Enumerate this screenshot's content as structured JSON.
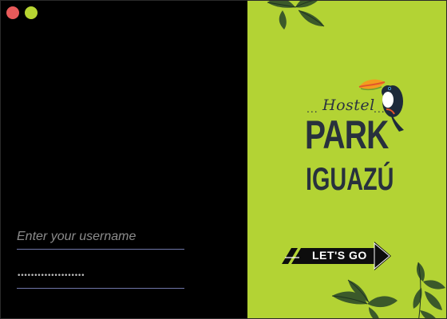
{
  "window": {
    "controls": [
      "close",
      "minimize"
    ]
  },
  "login": {
    "username_placeholder": "Enter your username",
    "password_value": "••••••••••••••••••••"
  },
  "brand": {
    "hostel": "Hostel",
    "dots_left": "...",
    "dots_right": "...",
    "park": "PARK",
    "iguazu": "IGUAZÚ"
  },
  "cta": {
    "label": "LET'S GO"
  },
  "colors": {
    "left_bg": "#000000",
    "right_bg": "#b3d334",
    "close_btn": "#e85a5a",
    "min_btn": "#b7d531",
    "input_underline": "#7077a9",
    "brand_text": "#28313d"
  },
  "icons": [
    "close-icon",
    "minimize-icon",
    "toucan-icon",
    "arrow-right-icon",
    "leaf-icon"
  ]
}
